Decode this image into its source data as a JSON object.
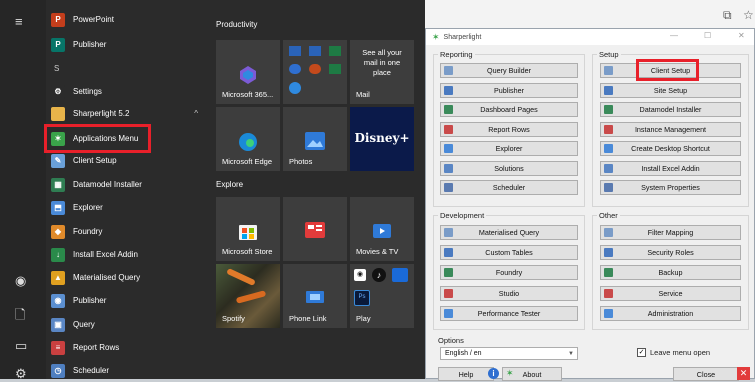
{
  "start_menu": {
    "apps": [
      {
        "label": "PowerPoint",
        "icon": "powerpoint-icon",
        "color": "#c43e1c",
        "glyph": "P"
      },
      {
        "label": "Publisher",
        "icon": "publisher-icon",
        "color": "#077568",
        "glyph": "P"
      },
      {
        "label": "Settings",
        "icon": "gear-icon",
        "color": "#2b2b2b",
        "glyph": "⚙"
      },
      {
        "label": "Sharperlight 5.2",
        "icon": "folder-icon",
        "color": "#e8b44a",
        "glyph": ""
      },
      {
        "label": "Applications Menu",
        "icon": "sharperlight-logo-icon",
        "color": "#3aa34a",
        "glyph": "✶"
      },
      {
        "label": "Client Setup",
        "icon": "client-setup-icon",
        "color": "#6aa0d8",
        "glyph": "✎"
      },
      {
        "label": "Datamodel Installer",
        "icon": "datamodel-installer-icon",
        "color": "#2f7d52",
        "glyph": "▦"
      },
      {
        "label": "Explorer",
        "icon": "explorer-icon",
        "color": "#4a8ad8",
        "glyph": "⬒"
      },
      {
        "label": "Foundry",
        "icon": "foundry-icon",
        "color": "#e08a2a",
        "glyph": "◆"
      },
      {
        "label": "Install Excel Addin",
        "icon": "excel-addin-icon",
        "color": "#2a8a4a",
        "glyph": "↓"
      },
      {
        "label": "Materialised Query",
        "icon": "materialised-query-icon",
        "color": "#e0a020",
        "glyph": "▲"
      },
      {
        "label": "Publisher",
        "icon": "sharperlight-publisher-icon",
        "color": "#5b8fd0",
        "glyph": "◉"
      },
      {
        "label": "Query",
        "icon": "query-icon",
        "color": "#5a86c4",
        "glyph": "▣"
      },
      {
        "label": "Report Rows",
        "icon": "report-rows-icon",
        "color": "#c94040",
        "glyph": "≡"
      },
      {
        "label": "Scheduler",
        "icon": "scheduler-icon",
        "color": "#4f7fc0",
        "glyph": "◷"
      }
    ],
    "letter_s": "S",
    "sections": {
      "productivity": "Productivity",
      "explore": "Explore"
    },
    "tiles": {
      "m365": "Microsoft 365...",
      "mail_text": "See all your mail in one place",
      "mail": "Mail",
      "edge": "Microsoft Edge",
      "photos": "Photos",
      "store": "Microsoft Store",
      "movies": "Movies & TV",
      "spotify": "Spotify",
      "phone_link": "Phone Link",
      "play": "Play",
      "disney": "Disney+"
    }
  },
  "window": {
    "title": "Sharperlight",
    "reporting_label": "Reporting",
    "reporting": [
      "Query Builder",
      "Publisher",
      "Dashboard Pages",
      "Report Rows",
      "Explorer",
      "Solutions",
      "Scheduler"
    ],
    "setup_label": "Setup",
    "setup": [
      "Client Setup",
      "Site Setup",
      "Datamodel Installer",
      "Instance Management",
      "Create Desktop Shortcut",
      "Install Excel Addin",
      "System Properties"
    ],
    "development_label": "Development",
    "development": [
      "Materialised Query",
      "Custom Tables",
      "Foundry",
      "Studio",
      "Performance Tester"
    ],
    "other_label": "Other",
    "other": [
      "Filter Mapping",
      "Security Roles",
      "Backup",
      "Service",
      "Administration"
    ],
    "options_label": "Options",
    "language": "English / en",
    "leave_menu_open": "Leave menu open",
    "help": "Help",
    "about": "About",
    "close": "Close"
  },
  "highlight_color": "#e8202a"
}
